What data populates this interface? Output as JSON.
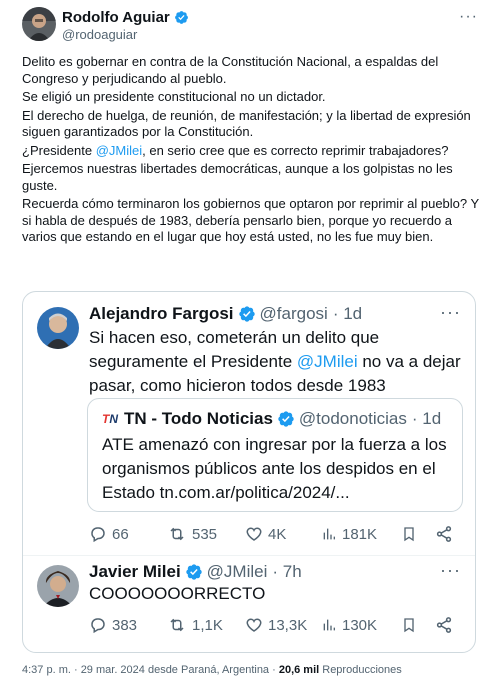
{
  "author": {
    "name": "Rodolfo Aguiar",
    "handle": "@rodoaguiar"
  },
  "post": {
    "para1": "Delito es gobernar en contra de la Constitución Nacional, a espaldas del Congreso y perjudicando al pueblo.",
    "para2": "Se eligió un presidente constitucional no un dictador.",
    "para3": "El derecho de huelga, de reunión, de manifestación; y la libertad de expresión siguen garantizados por la Constitución.",
    "para4_pre": "¿Presidente ",
    "para4_mention": "@JMilei",
    "para4_post": ", en serio cree que es correcto reprimir trabajadores?",
    "para5": "Ejercemos nuestras libertades democráticas, aunque a los golpistas no les guste.",
    "para6": "Recuerda cómo terminaron los gobiernos que optaron por reprimir al pueblo? Y si habla de después de 1983, debería pensarlo bien, porque yo recuerdo a varios que estando en el lugar que hoy está usted, no les fue muy bien."
  },
  "quote1": {
    "name": "Alejandro Fargosi",
    "handle": "@fargosi",
    "time": "· 1d",
    "text_line1": "Si hacen eso, cometerán un delito que",
    "text_line2_pre": "seguramente el Presidente ",
    "text_line2_mention": "@JMilei",
    "text_line2_post": " no va a dejar",
    "text_line3": "pasar, como hicieron todos desde 1983",
    "replies": "66",
    "retweets": "535",
    "likes": "4K",
    "views": "181K"
  },
  "nested": {
    "logo_t": "T",
    "logo_n": "N",
    "name": "TN - Todo Noticias",
    "handle": "@todonoticias",
    "time": "· 1d",
    "line1": "ATE amenazó con ingresar por la fuerza a los",
    "line2": "organismos públicos ante los despidos en el",
    "line3": "Estado tn.com.ar/politica/2024/..."
  },
  "quote2": {
    "name": "Javier Milei",
    "handle": "@JMilei",
    "time": "· 7h",
    "text": "COOOOOOORRECTO",
    "replies": "383",
    "retweets": "1,1K",
    "likes": "13,3K",
    "views": "130K"
  },
  "footer": {
    "time": "4:37 p. m. · 29 mar. 2024 desde Paraná, Argentina · ",
    "views": "20,6 mil",
    "views_label": " Reproducciones"
  },
  "colors": {
    "accent": "#1d9bf0",
    "secondary_text": "#536471",
    "border": "#cfd9de"
  }
}
